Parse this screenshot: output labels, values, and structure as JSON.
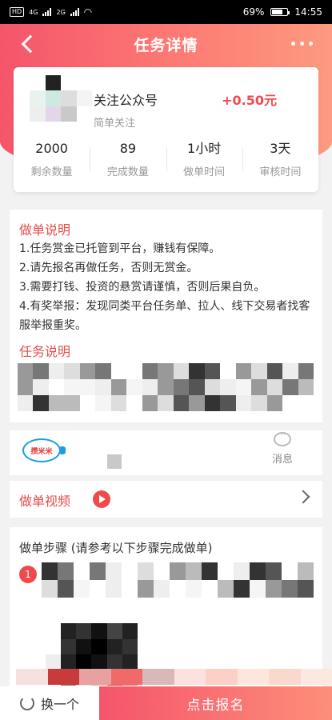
{
  "status_bar": {
    "sim_label": "HD",
    "net1": "4G",
    "net2": "2G",
    "battery_text": "69%",
    "time": "14:55"
  },
  "header": {
    "title": "任务详情",
    "back_icon": "back-arrow-icon",
    "more_icon": "more-dots-icon"
  },
  "task": {
    "name": "关注公众号",
    "subtitle": "简单关注",
    "reward": "+0.50元",
    "stats": [
      {
        "value": "2000",
        "label": "剩余数量"
      },
      {
        "value": "89",
        "label": "完成数量"
      },
      {
        "value": "1小时",
        "label": "做单时间"
      },
      {
        "value": "3天",
        "label": "审核时间"
      }
    ]
  },
  "instructions": {
    "title": "做单说明",
    "rules": [
      "1.任务赏金已托管到平台，赚钱有保障。",
      "2.请先报名再做任务，否则无赏金。",
      "3.需要打钱、投资的悬赏请谨慎，否则后果自负。",
      "4.有奖举报：发现同类平台任务单、拉人、线下交易者找客服举报重奖。"
    ],
    "task_desc_title": "任务说明"
  },
  "owner": {
    "logo_text": "攒米米",
    "message_label": "消息",
    "message_icon": "chat-bubble-icon"
  },
  "video": {
    "label": "做单视频",
    "icon": "play-icon"
  },
  "steps": {
    "title": "做单步骤 (请参考以下步骤完成做单)",
    "first_step_number": "1"
  },
  "bottom": {
    "switch_label": "换一个",
    "signup_label": "点击报名"
  },
  "colors": {
    "accent": "#f5556a",
    "accent_light": "#fd8e7a",
    "section_red": "#e54d4d"
  }
}
